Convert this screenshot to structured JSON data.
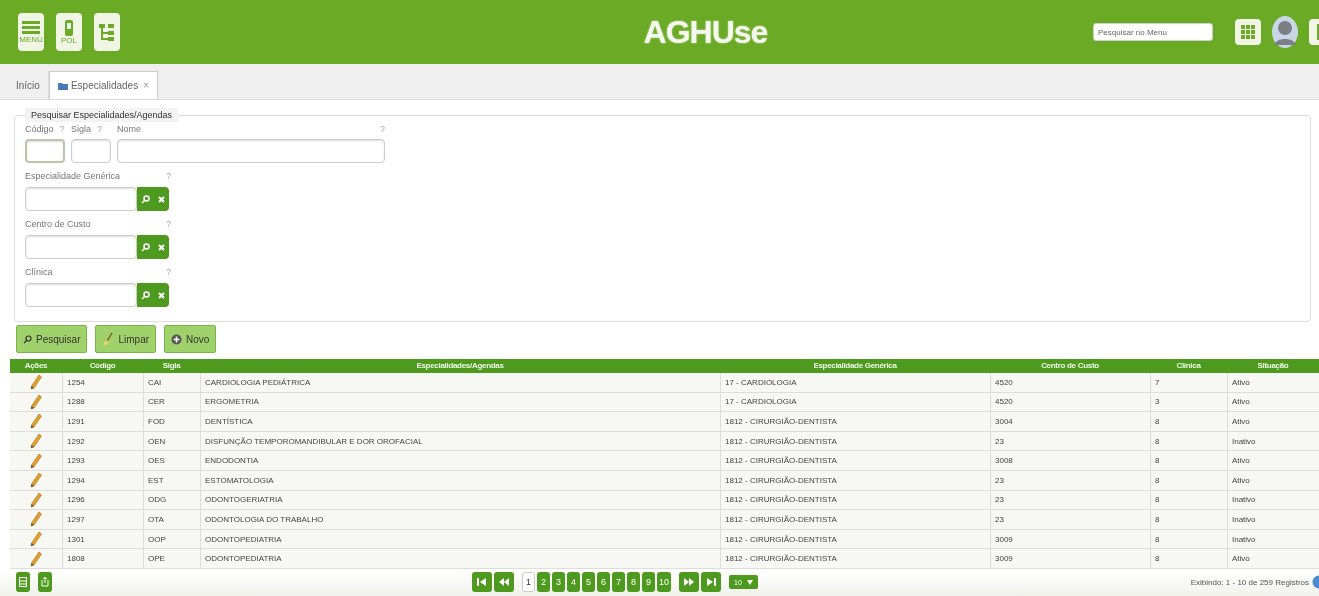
{
  "header": {
    "title": "AGHUse",
    "menu_label": "MENU",
    "pol_label": "POL",
    "search": {
      "placeholder": "Pesquisar no Menu"
    }
  },
  "tabs": [
    {
      "label": "Início",
      "selected": false,
      "closable": false
    },
    {
      "label": "Especialidades",
      "selected": true,
      "closable": true
    }
  ],
  "close_mark": "×",
  "form": {
    "legend": "Pesquisar Especialidades/Agendas",
    "help": "?",
    "top_fields": [
      {
        "label": "Código",
        "kind": "short",
        "focused": true
      },
      {
        "label": "Sigla",
        "kind": "short",
        "focused": false
      },
      {
        "label": "Nome",
        "kind": "wide",
        "focused": false
      }
    ],
    "lookups": [
      {
        "label": "Especialidade Genérica"
      },
      {
        "label": "Centro de Custo"
      },
      {
        "label": "Clínica"
      }
    ]
  },
  "actions": [
    {
      "label": "Pesquisar",
      "kind": "search"
    },
    {
      "label": "Limpar",
      "kind": "clear"
    },
    {
      "label": "Novo",
      "kind": "new"
    }
  ],
  "table": {
    "columns": [
      "Ações",
      "Código",
      "Sigla",
      "Especialidades/Agendas",
      "Especialidade Genérica",
      "Centro de Custo",
      "Clínica",
      "Situação"
    ],
    "rows": [
      [
        "1254",
        "CAI",
        "CARDIOLOGIA PEDIÁTRICA",
        "17 - CARDIOLOGIA",
        "4520",
        "7",
        "Ativo"
      ],
      [
        "1288",
        "CER",
        "ERGOMETRIA",
        "17 - CARDIOLOGIA",
        "4520",
        "3",
        "Ativo"
      ],
      [
        "1291",
        "FOD",
        "DENTÍSTICA",
        "1812 - CIRURGIÃO-DENTISTA",
        "3004",
        "8",
        "Ativo"
      ],
      [
        "1292",
        "OEN",
        "DISFUNÇÃO TEMPOROMANDIBULAR E DOR OROFACIAL",
        "1812 - CIRURGIÃO-DENTISTA",
        "23",
        "8",
        "Inativo"
      ],
      [
        "1293",
        "OES",
        "ENDODONTIA",
        "1812 - CIRURGIÃO-DENTISTA",
        "3008",
        "8",
        "Ativo"
      ],
      [
        "1294",
        "EST",
        "ESTOMATOLOGIA",
        "1812 - CIRURGIÃO-DENTISTA",
        "23",
        "8",
        "Ativo"
      ],
      [
        "1296",
        "ODG",
        "ODONTOGERIATRIA",
        "1812 - CIRURGIÃO-DENTISTA",
        "23",
        "8",
        "Inativo"
      ],
      [
        "1297",
        "OTA",
        "ODONTOLOGIA DO TRABALHO",
        "1812 - CIRURGIÃO-DENTISTA",
        "23",
        "8",
        "Inativo"
      ],
      [
        "1301",
        "OOP",
        "ODONTOPEDIATRIA",
        "1812 - CIRURGIÃO-DENTISTA",
        "3009",
        "8",
        "Inativo"
      ],
      [
        "1808",
        "OPE",
        "ODONTOPEDIATRIA",
        "1812 - CIRURGIÃO-DENTISTA",
        "3009",
        "8",
        "Ativo"
      ]
    ]
  },
  "pagination": {
    "pages": [
      {
        "label": "1",
        "selected": true
      },
      {
        "label": "2",
        "selected": false
      },
      {
        "label": "3",
        "selected": false
      },
      {
        "label": "4",
        "selected": false
      },
      {
        "label": "5",
        "selected": false
      },
      {
        "label": "6",
        "selected": false
      },
      {
        "label": "7",
        "selected": false
      },
      {
        "label": "8",
        "selected": false
      },
      {
        "label": "9",
        "selected": false
      },
      {
        "label": "10",
        "selected": false
      }
    ],
    "page_size": "10",
    "status": "Exibindo: 1 - 10 de 259 Registros"
  }
}
